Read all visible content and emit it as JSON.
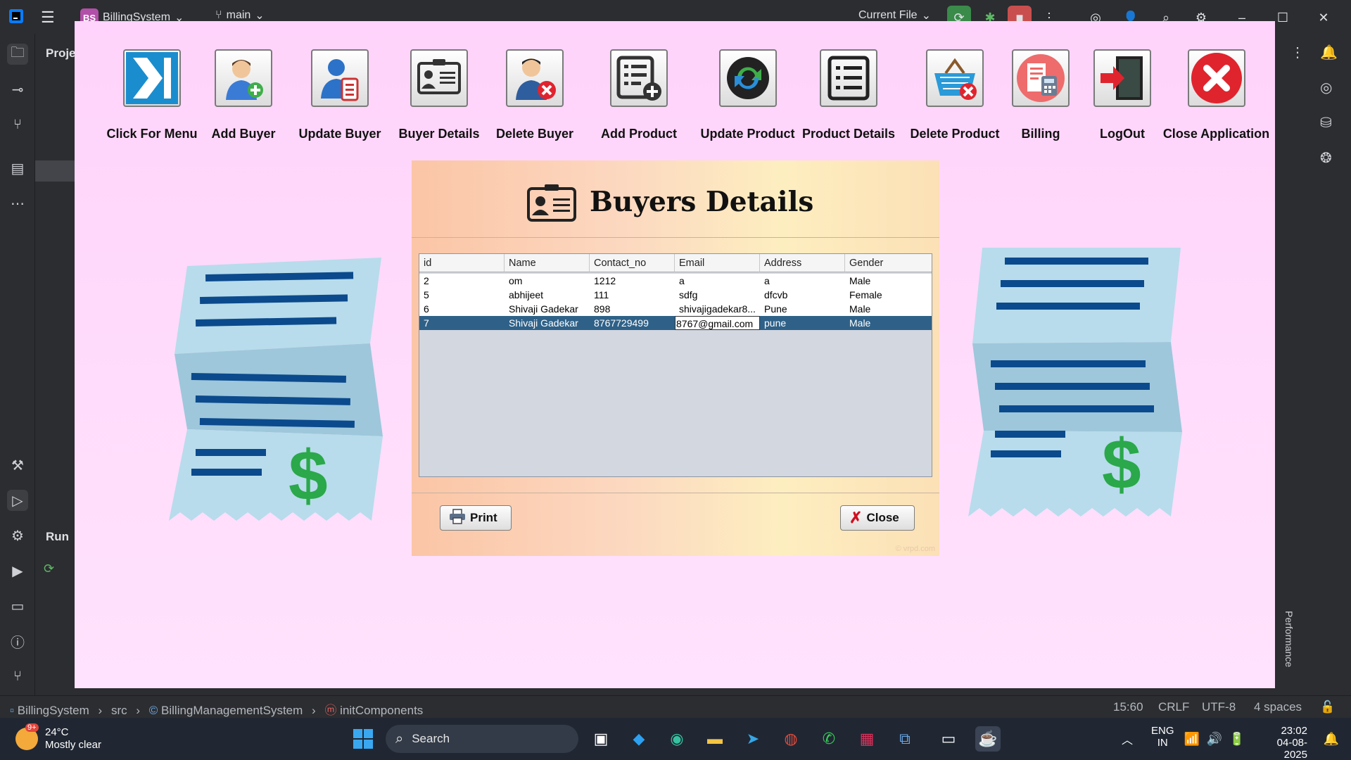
{
  "ide": {
    "project_badge": "BS",
    "project_name": "BillingSystem",
    "branch": "main",
    "run_config": "Current File",
    "project_panel_label": "Proje",
    "run_panel_label": "Run",
    "performance_label": "Performance",
    "breadcrumb": [
      "BillingSystem",
      "src",
      "BillingManagementSystem",
      "initComponents"
    ],
    "status": {
      "position": "15:60",
      "line_sep": "CRLF",
      "encoding": "UTF-8",
      "indent": "4 spaces"
    }
  },
  "app": {
    "menu": [
      {
        "label": "Click For Menu",
        "icon": "menu-arrow-icon"
      },
      {
        "label": "Add Buyer",
        "icon": "add-buyer-icon"
      },
      {
        "label": "Update Buyer",
        "icon": "update-buyer-icon"
      },
      {
        "label": "Buyer Details",
        "icon": "buyer-details-icon"
      },
      {
        "label": "Delete Buyer",
        "icon": "delete-buyer-icon"
      },
      {
        "label": "Add Product",
        "icon": "add-product-icon"
      },
      {
        "label": "Update Product",
        "icon": "update-product-icon"
      },
      {
        "label": "Product Details",
        "icon": "product-details-icon"
      },
      {
        "label": "Delete Product",
        "icon": "delete-product-icon"
      },
      {
        "label": "Billing",
        "icon": "billing-icon"
      },
      {
        "label": "LogOut",
        "icon": "logout-icon"
      },
      {
        "label": "Close Application",
        "icon": "close-app-icon"
      }
    ],
    "dialog": {
      "title": "Buyers Details",
      "columns": [
        "id",
        "Name",
        "Contact_no",
        "Email",
        "Address",
        "Gender"
      ],
      "rows": [
        [
          "2",
          "om",
          "1212",
          "a",
          "a",
          "Male"
        ],
        [
          "5",
          "abhijeet",
          "111",
          "sdfg",
          "dfcvb",
          "Female"
        ],
        [
          "6",
          "Shivaji Gadekar",
          "898",
          "shivajigadekar8...",
          "Pune",
          "Male"
        ],
        [
          "7",
          "Shivaji Gadekar",
          "8767729499",
          "8767@gmail.com",
          "pune",
          "Male"
        ]
      ],
      "selected_row": 3,
      "editing_cell": "8767@gmail.com",
      "print_label": "Print",
      "close_label": "Close",
      "watermark": "© vrpd.com"
    }
  },
  "taskbar": {
    "weather_temp": "24°C",
    "weather_desc": "Mostly clear",
    "weather_badge": "9+",
    "search_placeholder": "Search",
    "lang_top": "ENG",
    "lang_bottom": "IN",
    "time": "23:02",
    "date": "04-08-2025"
  },
  "colors": {
    "app_bg": "#ffd6fb",
    "table_selection": "#2f6188",
    "receipt_blue": "#0b4a8c",
    "receipt_paper": "#b8dceb",
    "dollar_green": "#2aa84a"
  }
}
